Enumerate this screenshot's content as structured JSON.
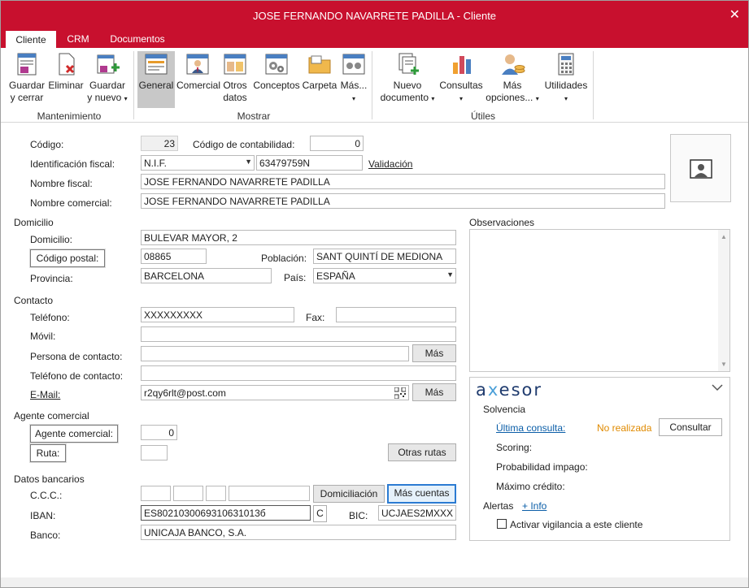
{
  "window": {
    "title": "JOSE FERNANDO NAVARRETE PADILLA - Cliente",
    "close": "✕"
  },
  "tabs": [
    "Cliente",
    "CRM",
    "Documentos"
  ],
  "ribbon": {
    "mantenimiento": {
      "label": "Mantenimiento",
      "guardar_cerrar": [
        "Guardar",
        "y cerrar"
      ],
      "eliminar": "Eliminar",
      "guardar_nuevo": [
        "Guardar",
        "y nuevo"
      ]
    },
    "mostrar": {
      "label": "Mostrar",
      "general": "General",
      "comercial": "Comercial",
      "otros_datos": [
        "Otros",
        "datos"
      ],
      "conceptos": "Conceptos",
      "carpeta": "Carpeta",
      "mas": "Más..."
    },
    "utiles": {
      "label": "Útiles",
      "nuevo_documento": [
        "Nuevo",
        "documento"
      ],
      "consultas": "Consultas",
      "mas_opciones": [
        "Más",
        "opciones..."
      ],
      "utilidades": "Utilidades"
    },
    "caret": "▾"
  },
  "form": {
    "codigo": {
      "label": "Código:",
      "value": "23"
    },
    "codigo_contabilidad": {
      "label": "Código de contabilidad:",
      "value": "0"
    },
    "identificacion": {
      "label": "Identificación fiscal:",
      "tipo": "N.I.F.",
      "value": "63479759N",
      "validacion": "Validación"
    },
    "nombre_fiscal": {
      "label": "Nombre fiscal:",
      "value": "JOSE FERNANDO NAVARRETE PADILLA"
    },
    "nombre_comercial": {
      "label": "Nombre comercial:",
      "value": "JOSE FERNANDO NAVARRETE PADILLA"
    },
    "domicilio_section": "Domicilio",
    "domicilio": {
      "label": "Domicilio:",
      "value": "BULEVAR MAYOR, 2"
    },
    "codigo_postal": {
      "label": "Código postal:",
      "value": "08865"
    },
    "poblacion": {
      "label": "Población:",
      "value": "SANT QUINTÍ DE MEDIONA"
    },
    "provincia": {
      "label": "Provincia:",
      "value": "BARCELONA"
    },
    "pais": {
      "label": "País:",
      "value": "ESPAÑA"
    },
    "contacto_section": "Contacto",
    "telefono": {
      "label": "Teléfono:",
      "value": "XXXXXXXXX"
    },
    "fax": {
      "label": "Fax:",
      "value": ""
    },
    "movil": {
      "label": "Móvil:",
      "value": ""
    },
    "persona_contacto": {
      "label": "Persona de contacto:",
      "value": "",
      "mas": "Más"
    },
    "telefono_contacto": {
      "label": "Teléfono de contacto:",
      "value": ""
    },
    "email": {
      "label": "E-Mail:",
      "value": "r2qy6rlt@post.com",
      "mas": "Más"
    },
    "agente_section": "Agente comercial",
    "agente": {
      "label": "Agente comercial:",
      "value": "0"
    },
    "ruta": {
      "label": "Ruta:",
      "value": "",
      "otras_rutas": "Otras rutas"
    },
    "bancarios_section": "Datos bancarios",
    "ccc": {
      "label": "C.C.C.:",
      "domiciliacion": "Domiciliación",
      "mas_cuentas": "Más cuentas"
    },
    "iban": {
      "label": "IBAN:",
      "value": "ES8021030069310631013б",
      "c": "C"
    },
    "bic": {
      "label": "BIC:",
      "value": "UCJAES2MXXX"
    },
    "banco": {
      "label": "Banco:",
      "value": "UNICAJA BANCO, S.A."
    }
  },
  "observaciones": {
    "label": "Observaciones",
    "value": ""
  },
  "axesor": {
    "logo": "axesor",
    "solvencia": "Solvencia",
    "ultima_consulta": "Última consulta:",
    "no_realizada": "No realizada",
    "consultar": "Consultar",
    "scoring": "Scoring:",
    "probabilidad": "Probabilidad impago:",
    "maximo": "Máximo crédito:",
    "alertas": "Alertas",
    "info": "+ Info",
    "vigilancia": "Activar vigilancia a este cliente"
  }
}
